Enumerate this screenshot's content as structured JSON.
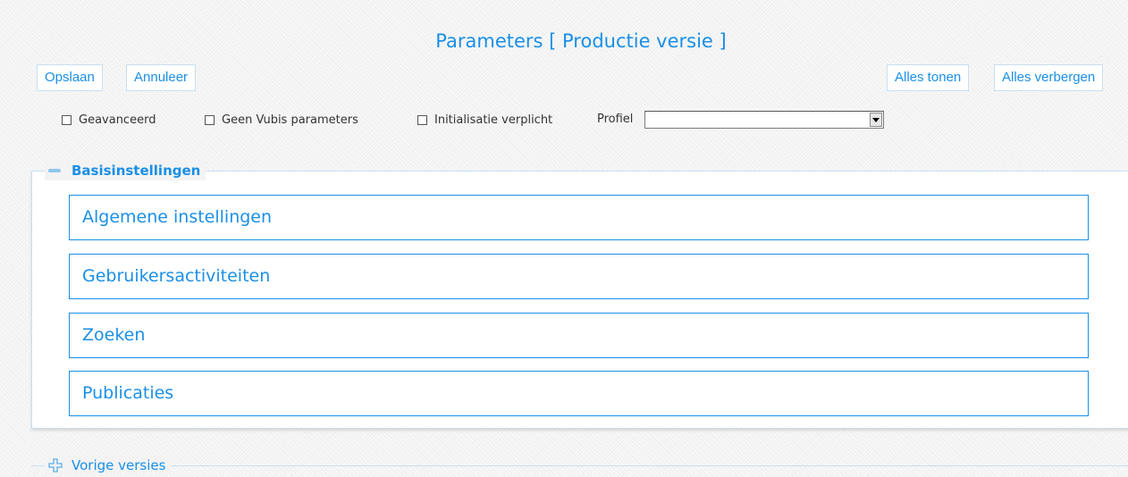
{
  "header": {
    "title": "Parameters [ Productie versie ]"
  },
  "toolbar": {
    "save_label": "Opslaan",
    "cancel_label": "Annuleer",
    "show_all_label": "Alles tonen",
    "hide_all_label": "Alles verbergen"
  },
  "filters": {
    "advanced_label": "Geavanceerd",
    "advanced_checked": false,
    "no_vubis_label": "Geen Vubis parameters",
    "no_vubis_checked": false,
    "init_required_label": "Initialisatie verplicht",
    "init_required_checked": false,
    "profile_label": "Profiel",
    "profile_value": ""
  },
  "basic_settings": {
    "legend": "Basisinstellingen",
    "expanded": true,
    "items": [
      {
        "label": "Algemene instellingen"
      },
      {
        "label": "Gebruikersactiviteiten"
      },
      {
        "label": "Zoeken"
      },
      {
        "label": "Publicaties"
      }
    ]
  },
  "previous_versions": {
    "legend": "Vorige versies",
    "expanded": false
  },
  "colors": {
    "accent": "#1a8fe6",
    "border_light": "#c5dff4",
    "background": "#f3f3f3"
  }
}
